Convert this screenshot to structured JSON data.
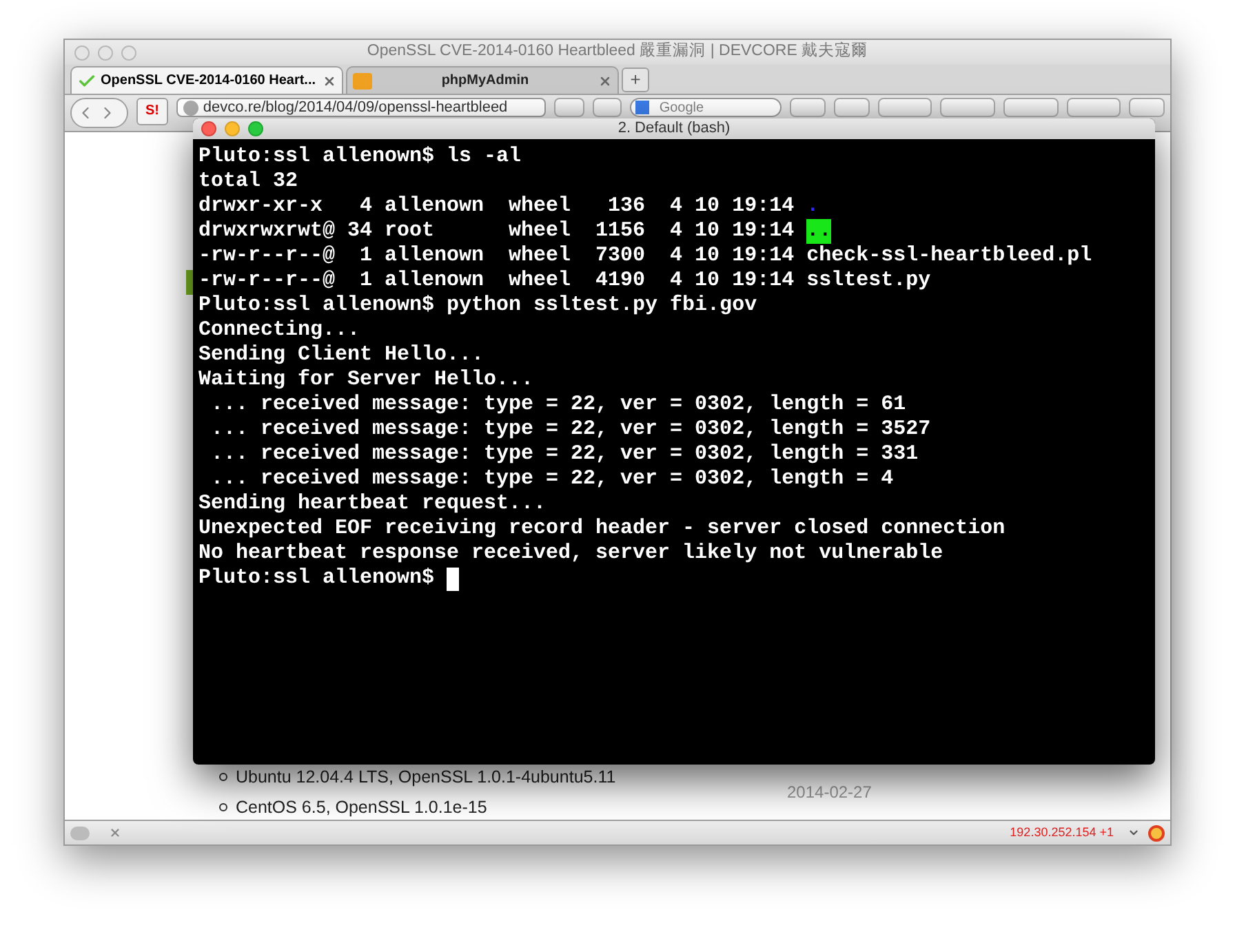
{
  "browser": {
    "title": "OpenSSL CVE-2014-0160 Heartbleed 嚴重漏洞 | DEVCORE 戴夫寇爾",
    "tabs": [
      {
        "label": "OpenSSL CVE-2014-0160 Heart...",
        "selected": true
      },
      {
        "label": "phpMyAdmin",
        "selected": false
      }
    ],
    "new_tab": "+",
    "bookmark": "S!",
    "address": "devco.re/blog/2014/04/09/openssl-heartbleed",
    "search": {
      "placeholder": "Google"
    },
    "page": {
      "list": [
        "Ubuntu 12.04.4 LTS, OpenSSL 1.0.1-4ubuntu5.11",
        "CentOS 6.5, OpenSSL 1.0.1e-15"
      ],
      "side_date": "2014-02-27"
    },
    "status": {
      "ip": "192.30.252.154 +1"
    }
  },
  "terminal": {
    "title": "2. Default (bash)",
    "lines": [
      {
        "text": "Pluto:ssl allenown$ ls -al"
      },
      {
        "text": "total 32"
      },
      {
        "text": "drwxr-xr-x   4 allenown  wheel   136  4 10 19:14 ",
        "entry": ".",
        "kind": "dir"
      },
      {
        "text": "drwxrwxrwt@ 34 root      wheel  1156  4 10 19:14 ",
        "entry": "..",
        "kind": "sticky"
      },
      {
        "text": "-rw-r--r--@  1 allenown  wheel  7300  4 10 19:14 ",
        "entry": "check-ssl-heartbleed.pl",
        "kind": "file"
      },
      {
        "text": "-rw-r--r--@  1 allenown  wheel  4190  4 10 19:14 ",
        "entry": "ssltest.py",
        "kind": "file"
      },
      {
        "text": "Pluto:ssl allenown$ python ssltest.py fbi.gov"
      },
      {
        "text": "Connecting..."
      },
      {
        "text": "Sending Client Hello..."
      },
      {
        "text": "Waiting for Server Hello..."
      },
      {
        "text": " ... received message: type = 22, ver = 0302, length = 61"
      },
      {
        "text": " ... received message: type = 22, ver = 0302, length = 3527"
      },
      {
        "text": " ... received message: type = 22, ver = 0302, length = 331"
      },
      {
        "text": " ... received message: type = 22, ver = 0302, length = 4"
      },
      {
        "text": "Sending heartbeat request..."
      },
      {
        "text": "Unexpected EOF receiving record header - server closed connection"
      },
      {
        "text": "No heartbeat response received, server likely not vulnerable"
      },
      {
        "text": "Pluto:ssl allenown$ ",
        "cursor": true
      }
    ]
  }
}
